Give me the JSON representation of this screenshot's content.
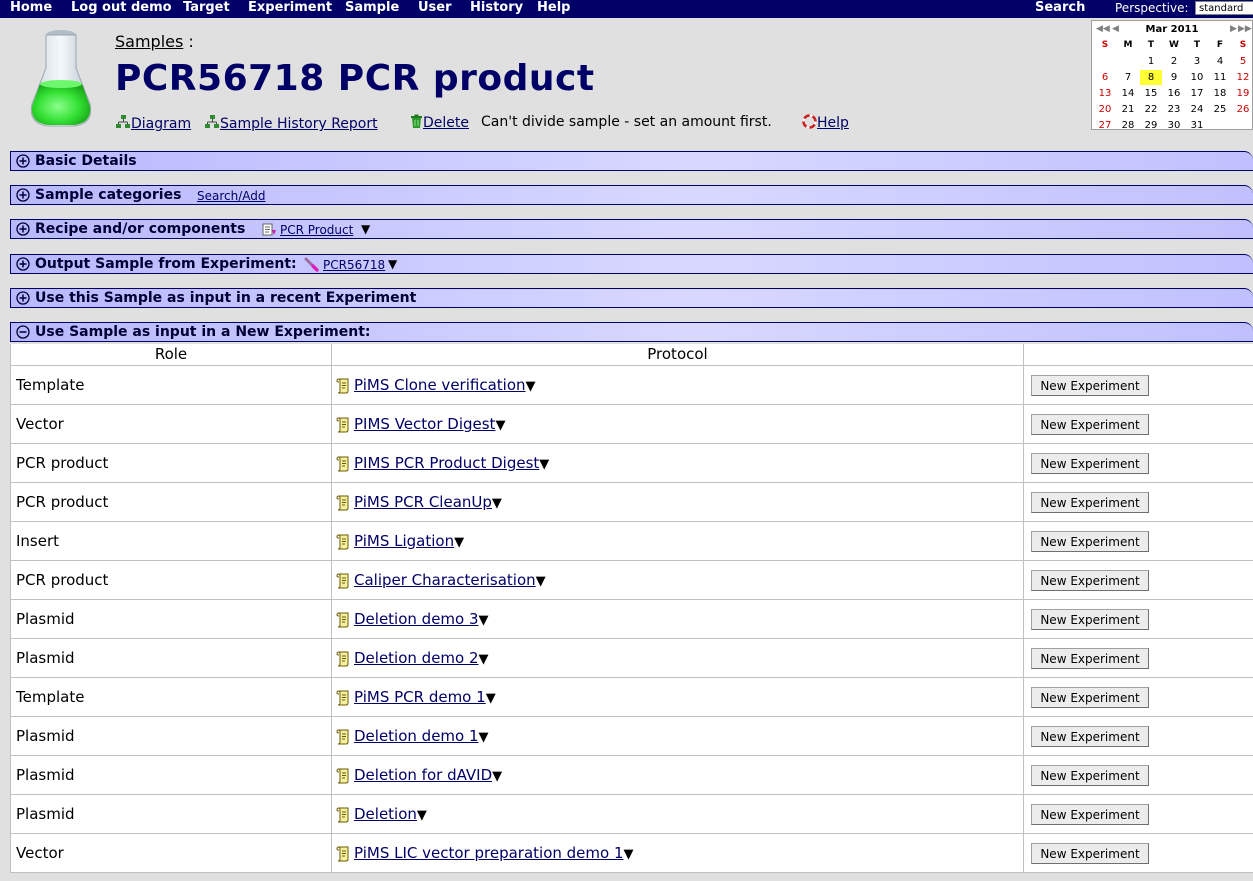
{
  "nav": {
    "items": [
      "Home",
      "Log out demo",
      "Target",
      "Experiment",
      "Sample",
      "User",
      "History",
      "Help"
    ],
    "search": "Search",
    "perspective_label": "Perspective:",
    "perspective_value": "standard"
  },
  "calendar": {
    "month": "Mar 2011",
    "prev_year": "◀◀",
    "prev_month": "◀",
    "next_month": "▶",
    "next_year": "▶▶",
    "days_header": [
      "S",
      "M",
      "T",
      "W",
      "T",
      "F",
      "S"
    ],
    "weeks": [
      [
        "",
        "",
        "1",
        "2",
        "3",
        "4",
        "5"
      ],
      [
        "6",
        "7",
        "8",
        "9",
        "10",
        "11",
        "12"
      ],
      [
        "13",
        "14",
        "15",
        "16",
        "17",
        "18",
        "19"
      ],
      [
        "20",
        "21",
        "22",
        "23",
        "24",
        "25",
        "26"
      ],
      [
        "27",
        "28",
        "29",
        "30",
        "31",
        "",
        ""
      ]
    ],
    "today": "8"
  },
  "header": {
    "breadcrumb_link": "Samples",
    "breadcrumb_sep": ":",
    "title": "PCR56718 PCR product",
    "diagram": "Diagram",
    "history_report": "Sample History Report",
    "delete": "Delete",
    "divide_notice": "Can't divide sample - set an amount first.",
    "help": "Help"
  },
  "sections": {
    "basic_details": "Basic Details",
    "sample_categories": "Sample categories",
    "search_add": "Search/Add",
    "recipe": "Recipe and/or components",
    "recipe_link": "PCR Product",
    "output_sample": "Output Sample from Experiment:",
    "output_link": "PCR56718",
    "recent_experiment": "Use this Sample as input in a recent Experiment",
    "new_experiment": "Use Sample as input in a New Experiment:",
    "dropdown_arrow": "▼"
  },
  "table": {
    "col_role": "Role",
    "col_protocol": "Protocol",
    "button_label": "New Experiment",
    "rows": [
      {
        "role": "Template",
        "protocol": "PiMS Clone verification"
      },
      {
        "role": "Vector",
        "protocol": "PIMS Vector Digest"
      },
      {
        "role": "PCR product",
        "protocol": "PIMS PCR Product Digest"
      },
      {
        "role": "PCR product",
        "protocol": "PiMS PCR CleanUp"
      },
      {
        "role": "Insert",
        "protocol": "PiMS Ligation"
      },
      {
        "role": "PCR product",
        "protocol": "Caliper Characterisation"
      },
      {
        "role": "Plasmid",
        "protocol": "Deletion demo 3"
      },
      {
        "role": "Plasmid",
        "protocol": "Deletion demo 2"
      },
      {
        "role": "Template",
        "protocol": "PiMS PCR demo 1"
      },
      {
        "role": "Plasmid",
        "protocol": "Deletion demo 1"
      },
      {
        "role": "Plasmid",
        "protocol": "Deletion for dAVID"
      },
      {
        "role": "Plasmid",
        "protocol": "Deletion"
      },
      {
        "role": "Vector",
        "protocol": "PiMS LIC vector preparation demo 1"
      }
    ]
  }
}
